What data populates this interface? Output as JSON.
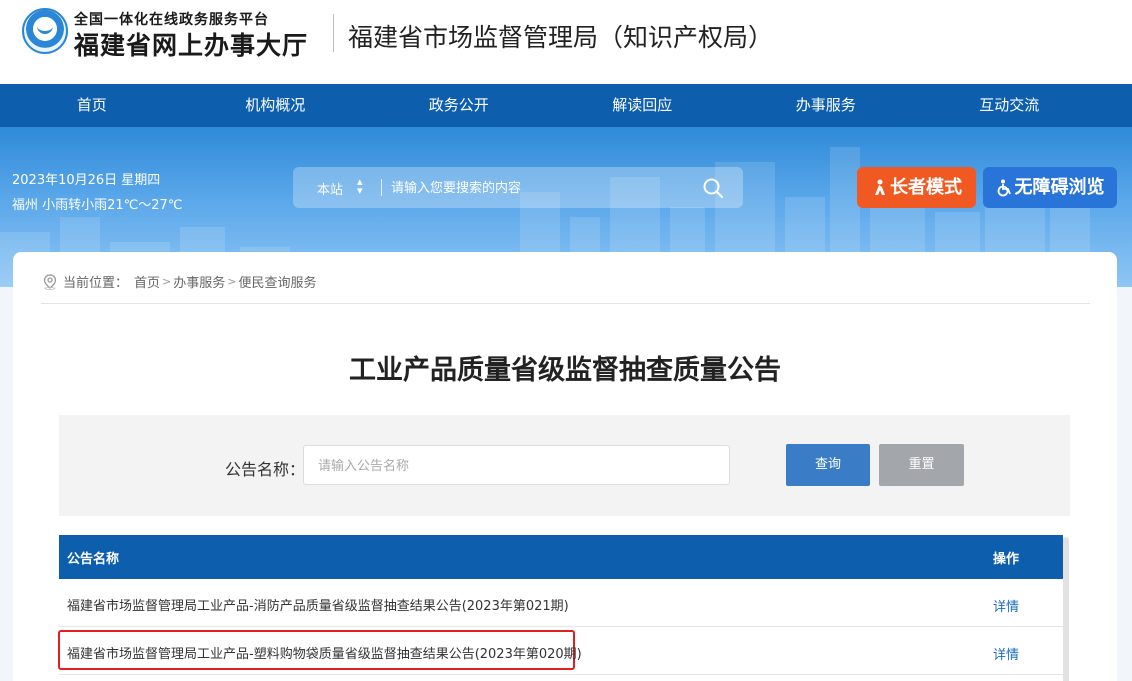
{
  "header": {
    "platform_line": "全国一体化在线政务服务平台",
    "platform_name": "福建省网上办事大厅",
    "site_title": "福建省市场监督管理局（知识产权局）"
  },
  "nav": {
    "items": [
      "首页",
      "机构概况",
      "政务公开",
      "解读回应",
      "办事服务",
      "互动交流"
    ]
  },
  "banner": {
    "date": "2023年10月26日 星期四",
    "weather": "福州 小雨转小雨21℃～27℃",
    "search": {
      "scope": "本站",
      "placeholder": "请输入您要搜索的内容",
      "icon": "search-icon"
    },
    "elder_mode": "长者模式",
    "accessible": "无障碍浏览"
  },
  "breadcrumb": {
    "prefix": "当前位置：",
    "items": [
      "首页",
      "办事服务",
      "便民查询服务"
    ]
  },
  "page_title": "工业产品质量省级监督抽查质量公告",
  "query": {
    "label": "公告名称：",
    "placeholder": "请输入公告名称",
    "value": "",
    "search_button": "查询",
    "reset_button": "重置"
  },
  "table": {
    "headers": [
      "公告名称",
      "操作"
    ],
    "rows": [
      {
        "name": "福建省市场监督管理局工业产品-消防产品质量省级监督抽查结果公告(2023年第021期)",
        "action": "详情"
      },
      {
        "name": "福建省市场监督管理局工业产品-塑料购物袋质量省级监督抽查结果公告(2023年第020期)",
        "action": "详情"
      }
    ]
  },
  "colors": {
    "nav_blue": "#0d5fae",
    "elder_orange": "#f05a22",
    "accessible_blue": "#2874d8",
    "highlight_red": "#e02020"
  }
}
